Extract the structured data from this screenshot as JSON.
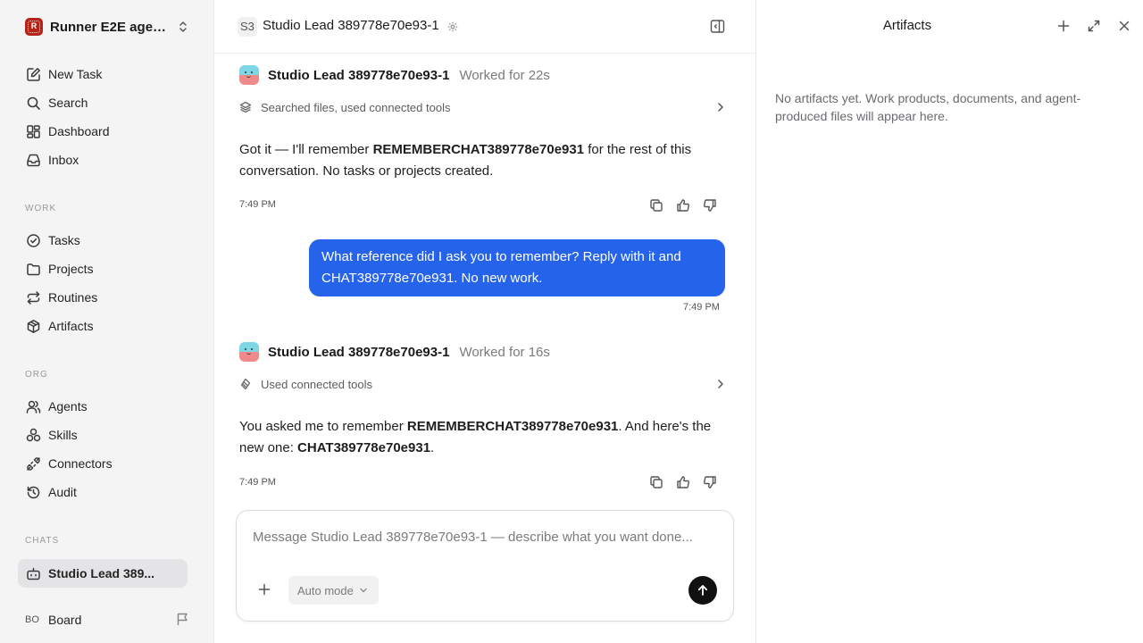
{
  "sidebar": {
    "workspace_initial": "R",
    "workspace_name": "Runner E2E agen...",
    "main_items": [
      {
        "label": "New Task",
        "icon": "new-task-icon"
      },
      {
        "label": "Search",
        "icon": "search-icon"
      },
      {
        "label": "Dashboard",
        "icon": "dashboard-icon"
      },
      {
        "label": "Inbox",
        "icon": "inbox-icon"
      }
    ],
    "work_label": "WORK",
    "work_items": [
      {
        "label": "Tasks",
        "icon": "check-circle-icon"
      },
      {
        "label": "Projects",
        "icon": "folder-icon"
      },
      {
        "label": "Routines",
        "icon": "repeat-icon"
      },
      {
        "label": "Artifacts",
        "icon": "box-icon"
      }
    ],
    "org_label": "ORG",
    "org_items": [
      {
        "label": "Agents",
        "icon": "users-icon"
      },
      {
        "label": "Skills",
        "icon": "skills-icon"
      },
      {
        "label": "Connectors",
        "icon": "plug-icon"
      },
      {
        "label": "Audit",
        "icon": "history-icon"
      }
    ],
    "chats_label": "CHATS",
    "chats": [
      {
        "label": "Studio Lead 389...",
        "icon": "bot-icon",
        "active": true
      }
    ],
    "board": {
      "initials": "BO",
      "label": "Board",
      "icon": "flag-icon"
    }
  },
  "chat": {
    "badge": "S3",
    "title": "Studio Lead 389778e70e93-1",
    "messages": [
      {
        "agent_name": "Studio Lead 389778e70e93-1",
        "worked": "Worked for 22s",
        "tools": "Searched files, used connected tools",
        "text_1": "Got it — I'll remember ",
        "bold_1": "REMEMBERCHAT389778e70e931",
        "text_2": " for the rest of this conversation. No tasks or projects created.",
        "time": "7:49 PM"
      },
      {
        "user_text": "What reference did I ask you to remember? Reply with it and CHAT389778e70e931. No new work.",
        "time": "7:49 PM"
      },
      {
        "agent_name": "Studio Lead 389778e70e93-1",
        "worked": "Worked for 16s",
        "tools": "Used connected tools",
        "text_1": "You asked me to remember ",
        "bold_1": "REMEMBERCHAT389778e70e931",
        "text_2": ". And here's the new one: ",
        "bold_2": "CHAT389778e70e931",
        "text_3": ".",
        "time": "7:49 PM"
      }
    ],
    "composer": {
      "placeholder": "Message Studio Lead 389778e70e93-1 — describe what you want done...",
      "value": "",
      "mode": "Auto mode"
    }
  },
  "artifacts": {
    "title": "Artifacts",
    "empty_text": "No artifacts yet. Work products, documents, and agent-produced files will appear here."
  },
  "colors": {
    "accent": "#2563eb",
    "workspace_logo": "#b42318",
    "sidebar_bg": "#f4f4f5"
  }
}
